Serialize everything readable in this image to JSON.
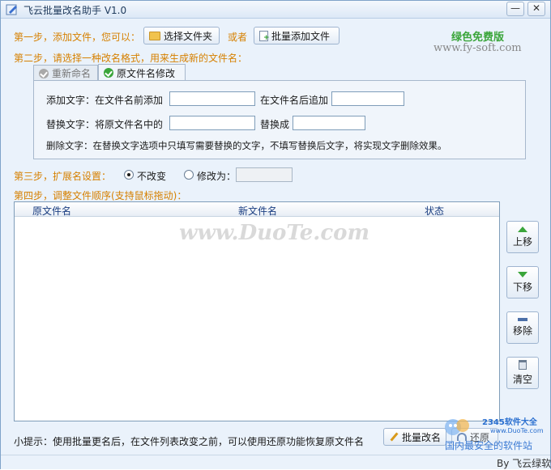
{
  "window": {
    "title": "飞云批量改名助手 V1.0",
    "minimize_glyph": "—",
    "close_glyph": "✕"
  },
  "step1": {
    "label": "第一步，添加文件，您可以：",
    "select_folder_button": "选择文件夹",
    "or_label": "或者",
    "batch_add_button": "批量添加文件"
  },
  "branding": {
    "green_edition": "绿色免费版",
    "website": "www.fy-soft.com"
  },
  "step2": {
    "label": "第二步，请选择一种改名格式，用来生成新的文件名：",
    "tabs": [
      {
        "label": "重新命名",
        "active": false
      },
      {
        "label": "原文件名修改",
        "active": true
      }
    ],
    "add_text_label": "添加文字：在文件名前添加",
    "add_text_prefix_value": "",
    "add_text_suffix_label": "在文件名后追加",
    "add_text_suffix_value": "",
    "replace_label": "替换文字：将原文件名中的",
    "replace_from_value": "",
    "replace_to_label": "替换成",
    "replace_to_value": "",
    "delete_label": "删除文字：在替换文字选项中只填写需要替换的文字，不填写替换后文字，将实现文字删除效果。"
  },
  "step3": {
    "label": "第三步，扩展名设置：",
    "option_unchanged": "不改变",
    "option_change": "修改为：",
    "selected": "不改变",
    "change_value": ""
  },
  "step4": {
    "label": "第四步，调整文件顺序(支持鼠标拖动)：",
    "columns": [
      "原文件名",
      "新文件名",
      "状态"
    ],
    "rows": []
  },
  "watermark": "www.DuoTe.com",
  "side_buttons": {
    "move_up": "上移",
    "move_down": "下移",
    "remove": "移除",
    "clear": "清空"
  },
  "footer": {
    "tip": "小提示：使用批量更名后，在文件列表改变之前，可以使用还原功能恢复原文件名",
    "batch_rename_button": "批量改名",
    "restore_button": "还原",
    "byline": "By 飞云绿软"
  },
  "corner_brand": {
    "name": "2345软件大全",
    "site": "www.DuoTe.com",
    "slogan": "国内最安全的软件站"
  },
  "colors": {
    "step_label": "#d68000",
    "green_edition": "#3aa53a",
    "column_header": "#1a3d80",
    "window_bg": "#eaf2fb"
  }
}
